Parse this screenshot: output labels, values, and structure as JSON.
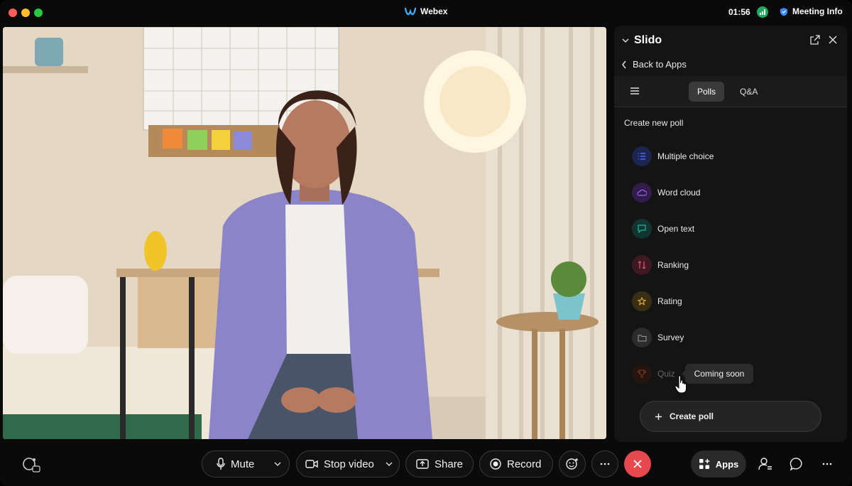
{
  "app": {
    "title": "Webex"
  },
  "titlebar": {
    "time": "01:56",
    "meeting_info_label": "Meeting Info"
  },
  "slido": {
    "title": "Slido",
    "back_label": "Back to Apps",
    "tabs": [
      {
        "label": "Polls",
        "active": true
      },
      {
        "label": "Q&A",
        "active": false
      }
    ],
    "create_heading": "Create new poll",
    "poll_types": [
      {
        "label": "Multiple choice",
        "icon": "list-icon",
        "color": "#4a6cf7"
      },
      {
        "label": "Word cloud",
        "icon": "cloud-icon",
        "color": "#a15ef0"
      },
      {
        "label": "Open text",
        "icon": "chat-icon",
        "color": "#22b59a"
      },
      {
        "label": "Ranking",
        "icon": "sort-icon",
        "color": "#e0546e"
      },
      {
        "label": "Rating",
        "icon": "star-icon",
        "color": "#e0b43a"
      },
      {
        "label": "Survey",
        "icon": "folder-icon",
        "color": "#8a8a8a"
      },
      {
        "label": "Quiz",
        "icon": "trophy-icon",
        "color": "#c2552c",
        "disabled": true
      }
    ],
    "tooltip": "Coming soon",
    "create_poll_label": "Create poll"
  },
  "toolbar": {
    "mute_label": "Mute",
    "stop_video_label": "Stop video",
    "share_label": "Share",
    "record_label": "Record",
    "apps_label": "Apps"
  },
  "colors": {
    "end_call": "#e5484d",
    "panel_bg": "#141414",
    "accent_green": "#1fa862"
  }
}
